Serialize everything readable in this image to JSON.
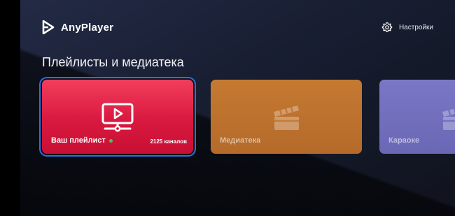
{
  "app": {
    "name": "AnyPlayer",
    "icon": "anyplayer-logo-icon"
  },
  "header": {
    "settings_label": "Настройки",
    "settings_icon": "gear-icon"
  },
  "section": {
    "title": "Плейлисты и медиатека"
  },
  "cards": [
    {
      "label": "Ваш плейлист",
      "count": "2125 каналов",
      "icon": "playlist-monitor-icon",
      "selected": true,
      "status_color": "#35d04a"
    },
    {
      "label": "Медиатека",
      "icon": "clapperboard-icon"
    },
    {
      "label": "Караоке",
      "icon": "clapperboard-icon"
    }
  ],
  "colors": {
    "accent_selected_border": "#2f6fe0",
    "playlist_card": "#e0213f",
    "media_card": "#c07431",
    "karaoke_card": "#726fbe"
  }
}
